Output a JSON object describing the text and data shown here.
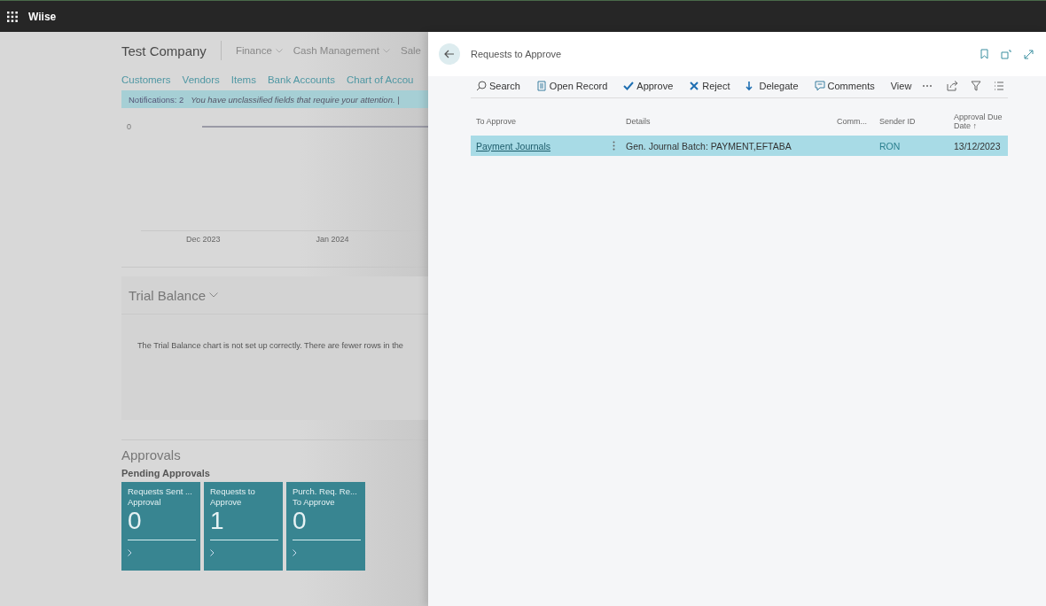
{
  "app_bar": {
    "title": "Wiise"
  },
  "company": {
    "name": "Test Company",
    "menus": [
      {
        "label": "Finance",
        "dropdown": true
      },
      {
        "label": "Cash Management",
        "dropdown": true
      },
      {
        "label": "Sale",
        "dropdown": false
      }
    ]
  },
  "nav_links": [
    "Customers",
    "Vendors",
    "Items",
    "Bank Accounts",
    "Chart of Accou"
  ],
  "notification": {
    "count": "Notifications: 2",
    "message": "You have unclassified fields that require your attention. |"
  },
  "chart": {
    "y_tick": "0",
    "x_labels": [
      "Dec 2023",
      "Jan 2024"
    ]
  },
  "trial_balance": {
    "title": "Trial Balance",
    "message": "The Trial Balance chart is not set up correctly. There are fewer rows in the"
  },
  "approvals": {
    "title": "Approvals",
    "subtitle": "Pending Approvals",
    "tiles": [
      {
        "label": "Requests Sent ... Approval",
        "value": "0"
      },
      {
        "label": "Requests to Approve",
        "value": "1"
      },
      {
        "label": "Purch. Req. Re... To Approve",
        "value": "0"
      }
    ]
  },
  "panel": {
    "title": "Requests to Approve",
    "actions": [
      "Search",
      "Open Record",
      "Approve",
      "Reject",
      "Delegate",
      "Comments",
      "View"
    ],
    "columns": [
      "To Approve",
      "Details",
      "Comm...",
      "Sender ID",
      "Approval Due Date ↑"
    ],
    "rows": [
      {
        "selected": true,
        "cells": [
          "Payment Journals",
          "Gen. Journal Batch: PAYMENT,EFTABA",
          "",
          "RON",
          "13/12/2023"
        ]
      }
    ]
  }
}
